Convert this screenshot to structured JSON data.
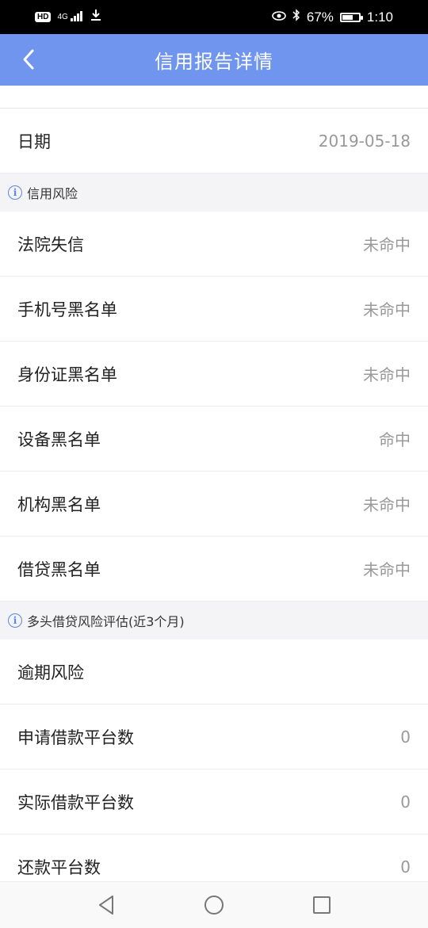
{
  "status_bar": {
    "left": {
      "hd": "HD",
      "network": "4G",
      "signal_icon": "signal-icon",
      "download_icon": "download-icon"
    },
    "right": {
      "battery_percent": "67%",
      "time": "1:10"
    }
  },
  "header": {
    "title": "信用报告详情"
  },
  "date_row": {
    "label": "日期",
    "value": "2019-05-18"
  },
  "sections": [
    {
      "title": "信用风险",
      "rows": [
        {
          "label": "法院失信",
          "value": "未命中"
        },
        {
          "label": "手机号黑名单",
          "value": "未命中"
        },
        {
          "label": "身份证黑名单",
          "value": "未命中"
        },
        {
          "label": "设备黑名单",
          "value": "命中"
        },
        {
          "label": "机构黑名单",
          "value": "未命中"
        },
        {
          "label": "借贷黑名单",
          "value": "未命中"
        }
      ]
    },
    {
      "title": "多头借贷风险评估(近3个月)",
      "rows": [
        {
          "label": "逾期风险",
          "value": ""
        },
        {
          "label": "申请借款平台数",
          "value": "0"
        },
        {
          "label": "实际借款平台数",
          "value": "0"
        },
        {
          "label": "还款平台数",
          "value": "0"
        }
      ]
    }
  ],
  "colors": {
    "header_bg": "#6f95ef",
    "info_icon": "#5b86e5",
    "value_text": "#999999"
  }
}
